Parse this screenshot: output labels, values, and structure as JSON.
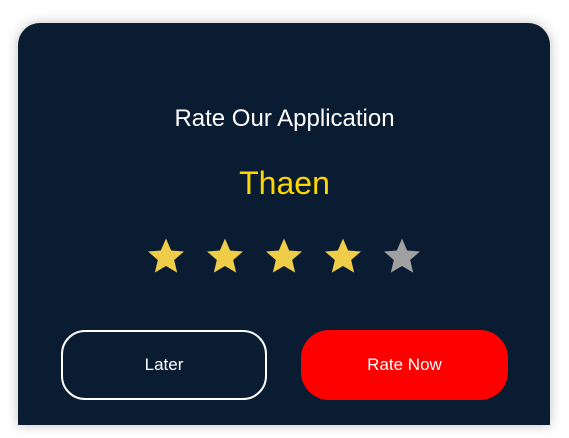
{
  "dialog": {
    "title": "Rate Our Application",
    "app_name": "Thaen",
    "app_name_color": "#ffd700",
    "rating": 4,
    "max_rating": 5,
    "star_filled_color": "#f0cd48",
    "star_empty_color": "#a0a0a0",
    "later_label": "Later",
    "rate_now_label": "Rate Now",
    "rate_now_color": "#ff0000"
  }
}
